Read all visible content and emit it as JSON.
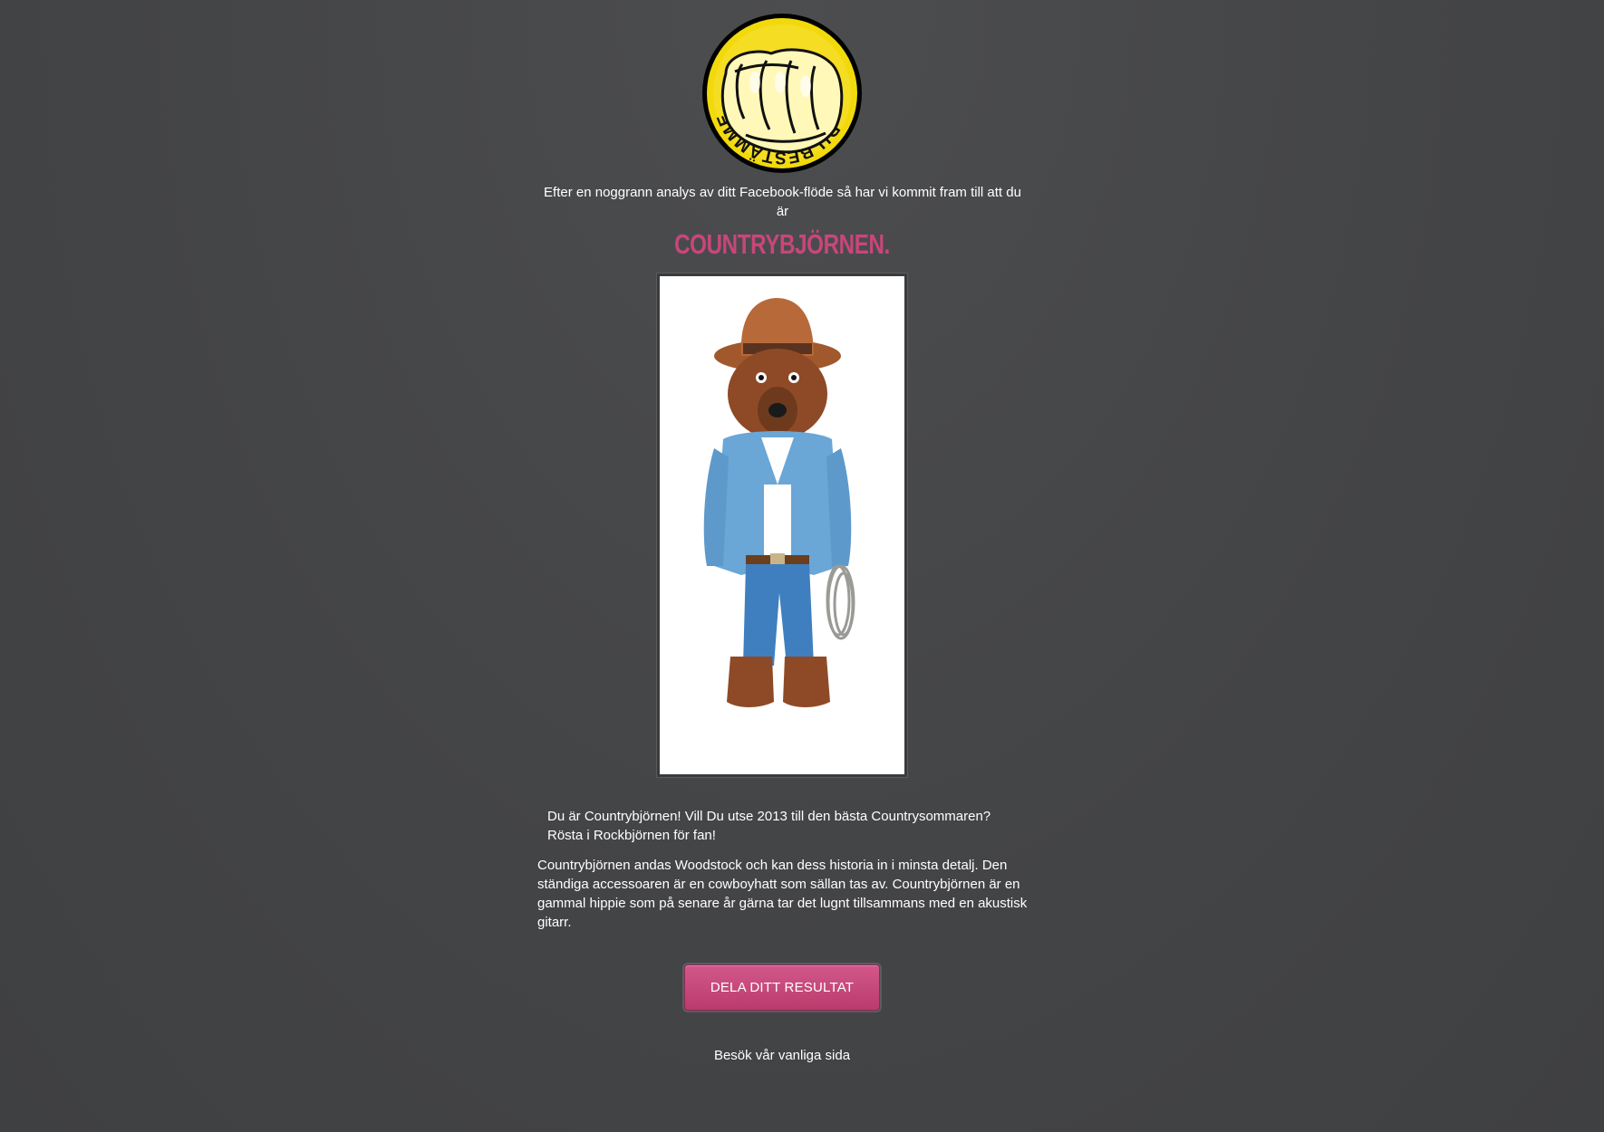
{
  "logo": {
    "text": "DU BESTÄMMER!",
    "icon": "fist-badge-icon",
    "colors": {
      "fill": "#f2d90c",
      "outline": "#000000"
    }
  },
  "intro_text": "Efter en noggrann analys av ditt Facebook-flöde så har vi kommit fram till att du är",
  "result_title": "COUNTRYBJÖRNEN.",
  "bear_image": {
    "icon": "cowboy-bear-illustration"
  },
  "headline_line1": "Du är Countrybjörnen! Vill Du utse 2013 till den bästa Countrysommaren?",
  "headline_line2": "Rösta i Rockbjörnen för fan!",
  "description": "Countrybjörnen andas Woodstock och kan dess historia in i minsta detalj.  Den ständiga accessoaren är en cowboyhatt som sällan tas av. Countrybjörnen är en gammal hippie som på senare år gärna tar det lugnt tillsammans med en akustisk gitarr.",
  "share_button": "DELA DITT RESULTAT",
  "visit_link": "Besök vår vanliga sida",
  "colors": {
    "background": "#454648",
    "accent": "#c9467a",
    "button": "#c34a7a"
  }
}
